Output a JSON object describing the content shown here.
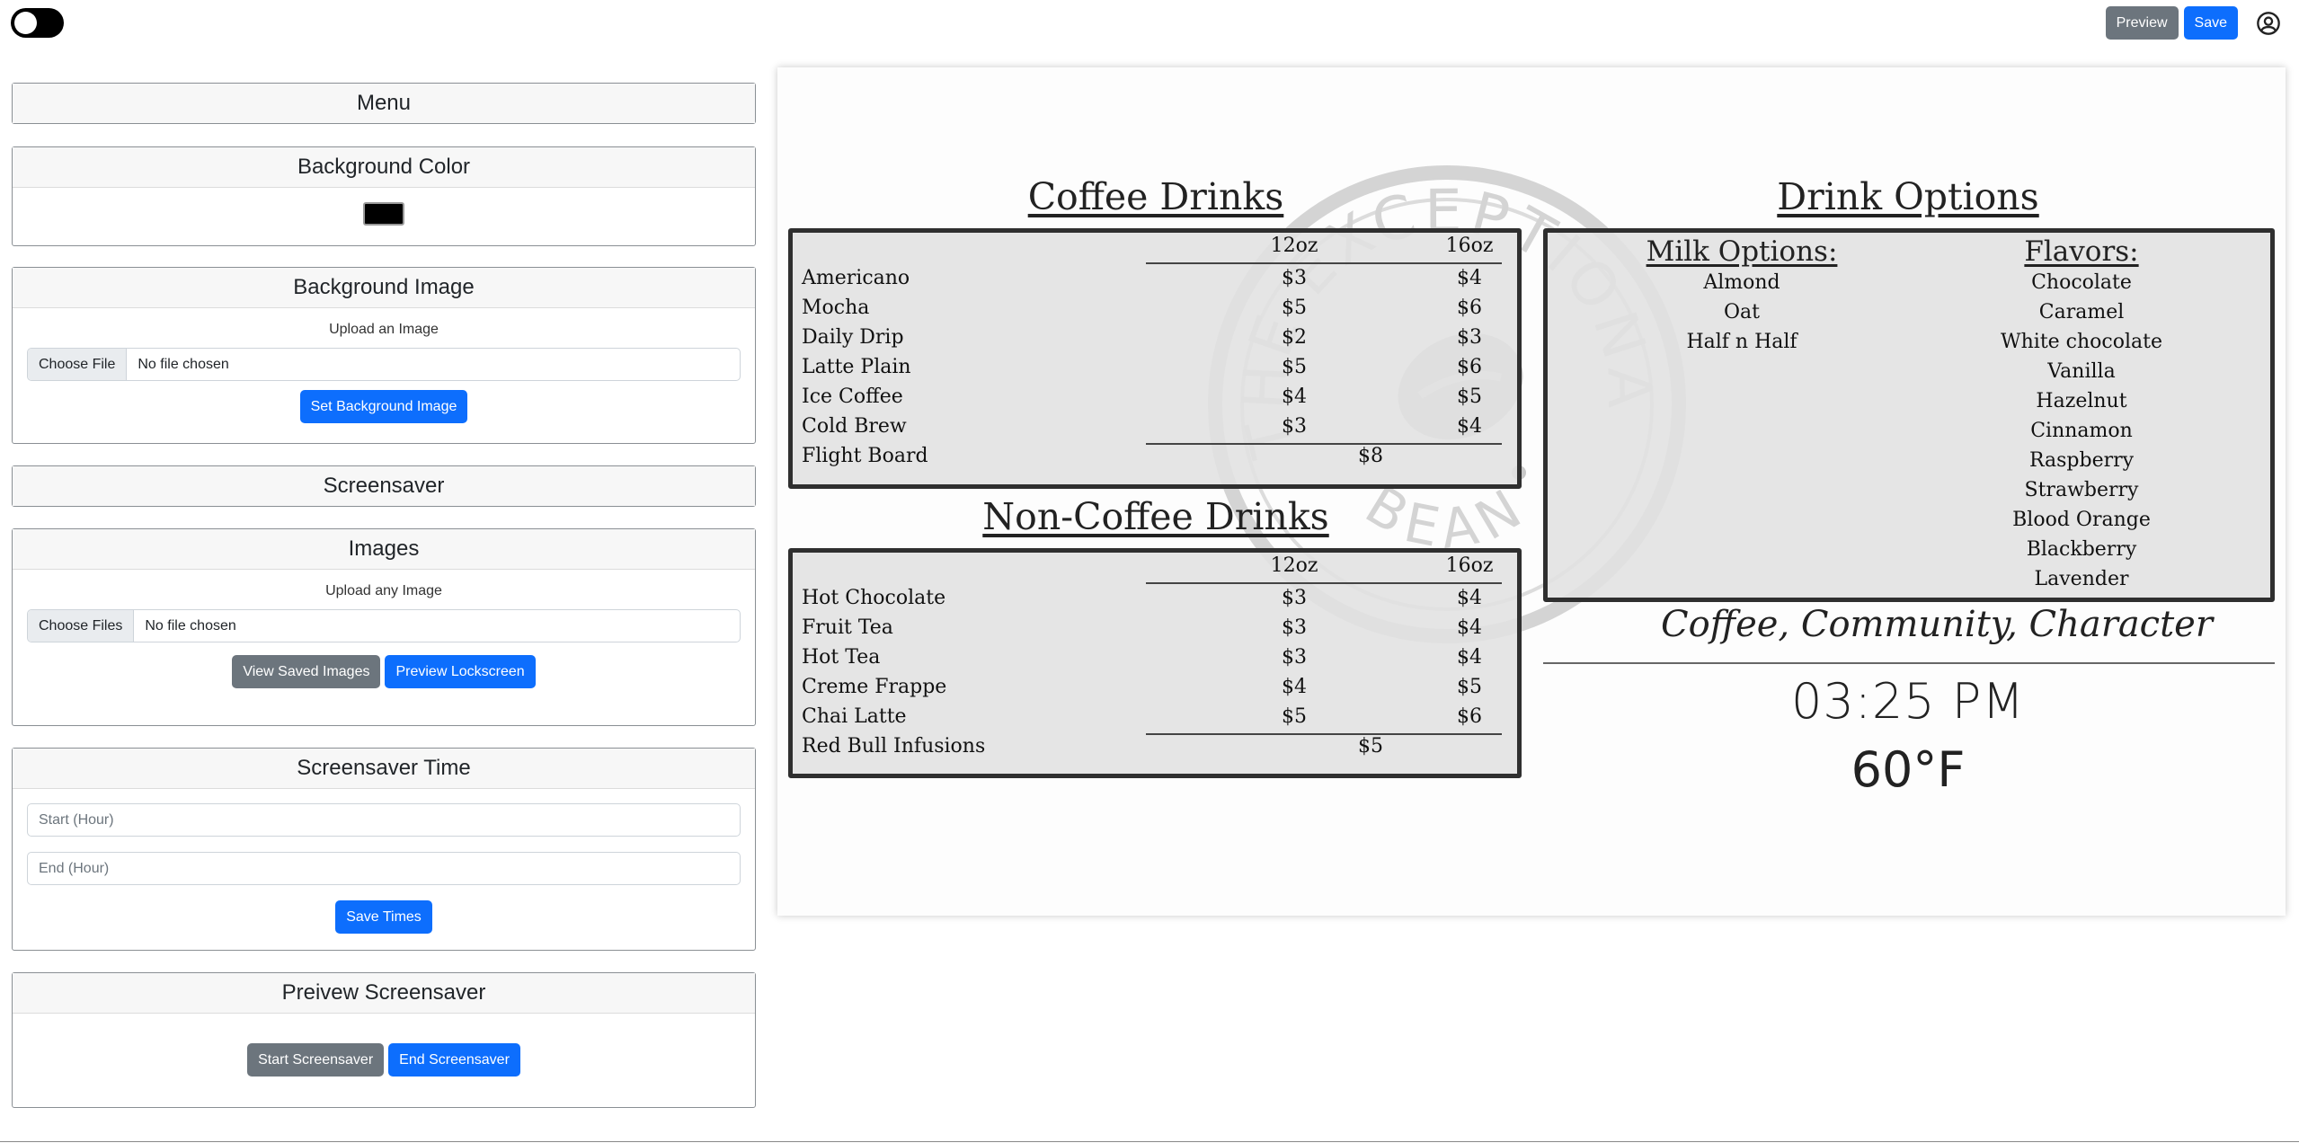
{
  "topbar": {
    "preview_label": "Preview",
    "save_label": "Save"
  },
  "panel": {
    "menu_title": "Menu",
    "bg_color_title": "Background Color",
    "bg_color_value": "#000000",
    "bg_image_title": "Background Image",
    "bg_image_upload_label": "Upload an Image",
    "bg_image_choose": "Choose File",
    "bg_image_file": "No file chosen",
    "bg_image_button": "Set Background Image",
    "screensaver_title": "Screensaver",
    "images_title": "Images",
    "images_upload_label": "Upload any Image",
    "images_choose": "Choose Files",
    "images_file": "No file chosen",
    "view_saved_button": "View Saved Images",
    "preview_lock_button": "Preview Lockscreen",
    "time_title": "Screensaver Time",
    "start_placeholder": "Start (Hour)",
    "end_placeholder": "End (Hour)",
    "save_times_button": "Save Times",
    "preview_ss_title": "Preivew Screensaver",
    "start_ss_button": "Start Screensaver",
    "end_ss_button": "End Screensaver"
  },
  "menu": {
    "coffee_title": "Coffee Drinks",
    "coffee_sizes": [
      "12oz",
      "16oz"
    ],
    "coffee_items": [
      {
        "name": "Americano",
        "p12": "$3",
        "p16": "$4"
      },
      {
        "name": "Mocha",
        "p12": "$5",
        "p16": "$6"
      },
      {
        "name": "Daily Drip",
        "p12": "$2",
        "p16": "$3"
      },
      {
        "name": "Latte Plain",
        "p12": "$5",
        "p16": "$6"
      },
      {
        "name": "Ice Coffee",
        "p12": "$4",
        "p16": "$5"
      },
      {
        "name": "Cold Brew",
        "p12": "$3",
        "p16": "$4"
      }
    ],
    "coffee_special": {
      "name": "Flight Board",
      "price": "$8"
    },
    "noncoffee_title": "Non-Coffee Drinks",
    "noncoffee_sizes": [
      "12oz",
      "16oz"
    ],
    "noncoffee_items": [
      {
        "name": "Hot Chocolate",
        "p12": "$3",
        "p16": "$4"
      },
      {
        "name": "Fruit Tea",
        "p12": "$3",
        "p16": "$4"
      },
      {
        "name": "Hot Tea",
        "p12": "$3",
        "p16": "$4"
      },
      {
        "name": "Creme Frappe",
        "p12": "$4",
        "p16": "$5"
      },
      {
        "name": "Chai Latte",
        "p12": "$5",
        "p16": "$6"
      }
    ],
    "noncoffee_special": {
      "name": "Red Bull Infusions",
      "price": "$5"
    },
    "options_title": "Drink Options",
    "milk_title": "Milk Options:",
    "milk": [
      "Almond",
      "Oat",
      "Half n Half"
    ],
    "flavors_title": "Flavors:",
    "flavors": [
      "Chocolate",
      "Caramel",
      "White chocolate",
      "Vanilla",
      "Hazelnut",
      "Cinnamon",
      "Raspberry",
      "Strawberry",
      "Blood Orange",
      "Blackberry",
      "Lavender"
    ],
    "tagline": "Coffee, Community, Character",
    "time": "03:25 PM",
    "temperature": "60°F",
    "watermark_text": "THE EXCEPTIONAL BEAN"
  }
}
